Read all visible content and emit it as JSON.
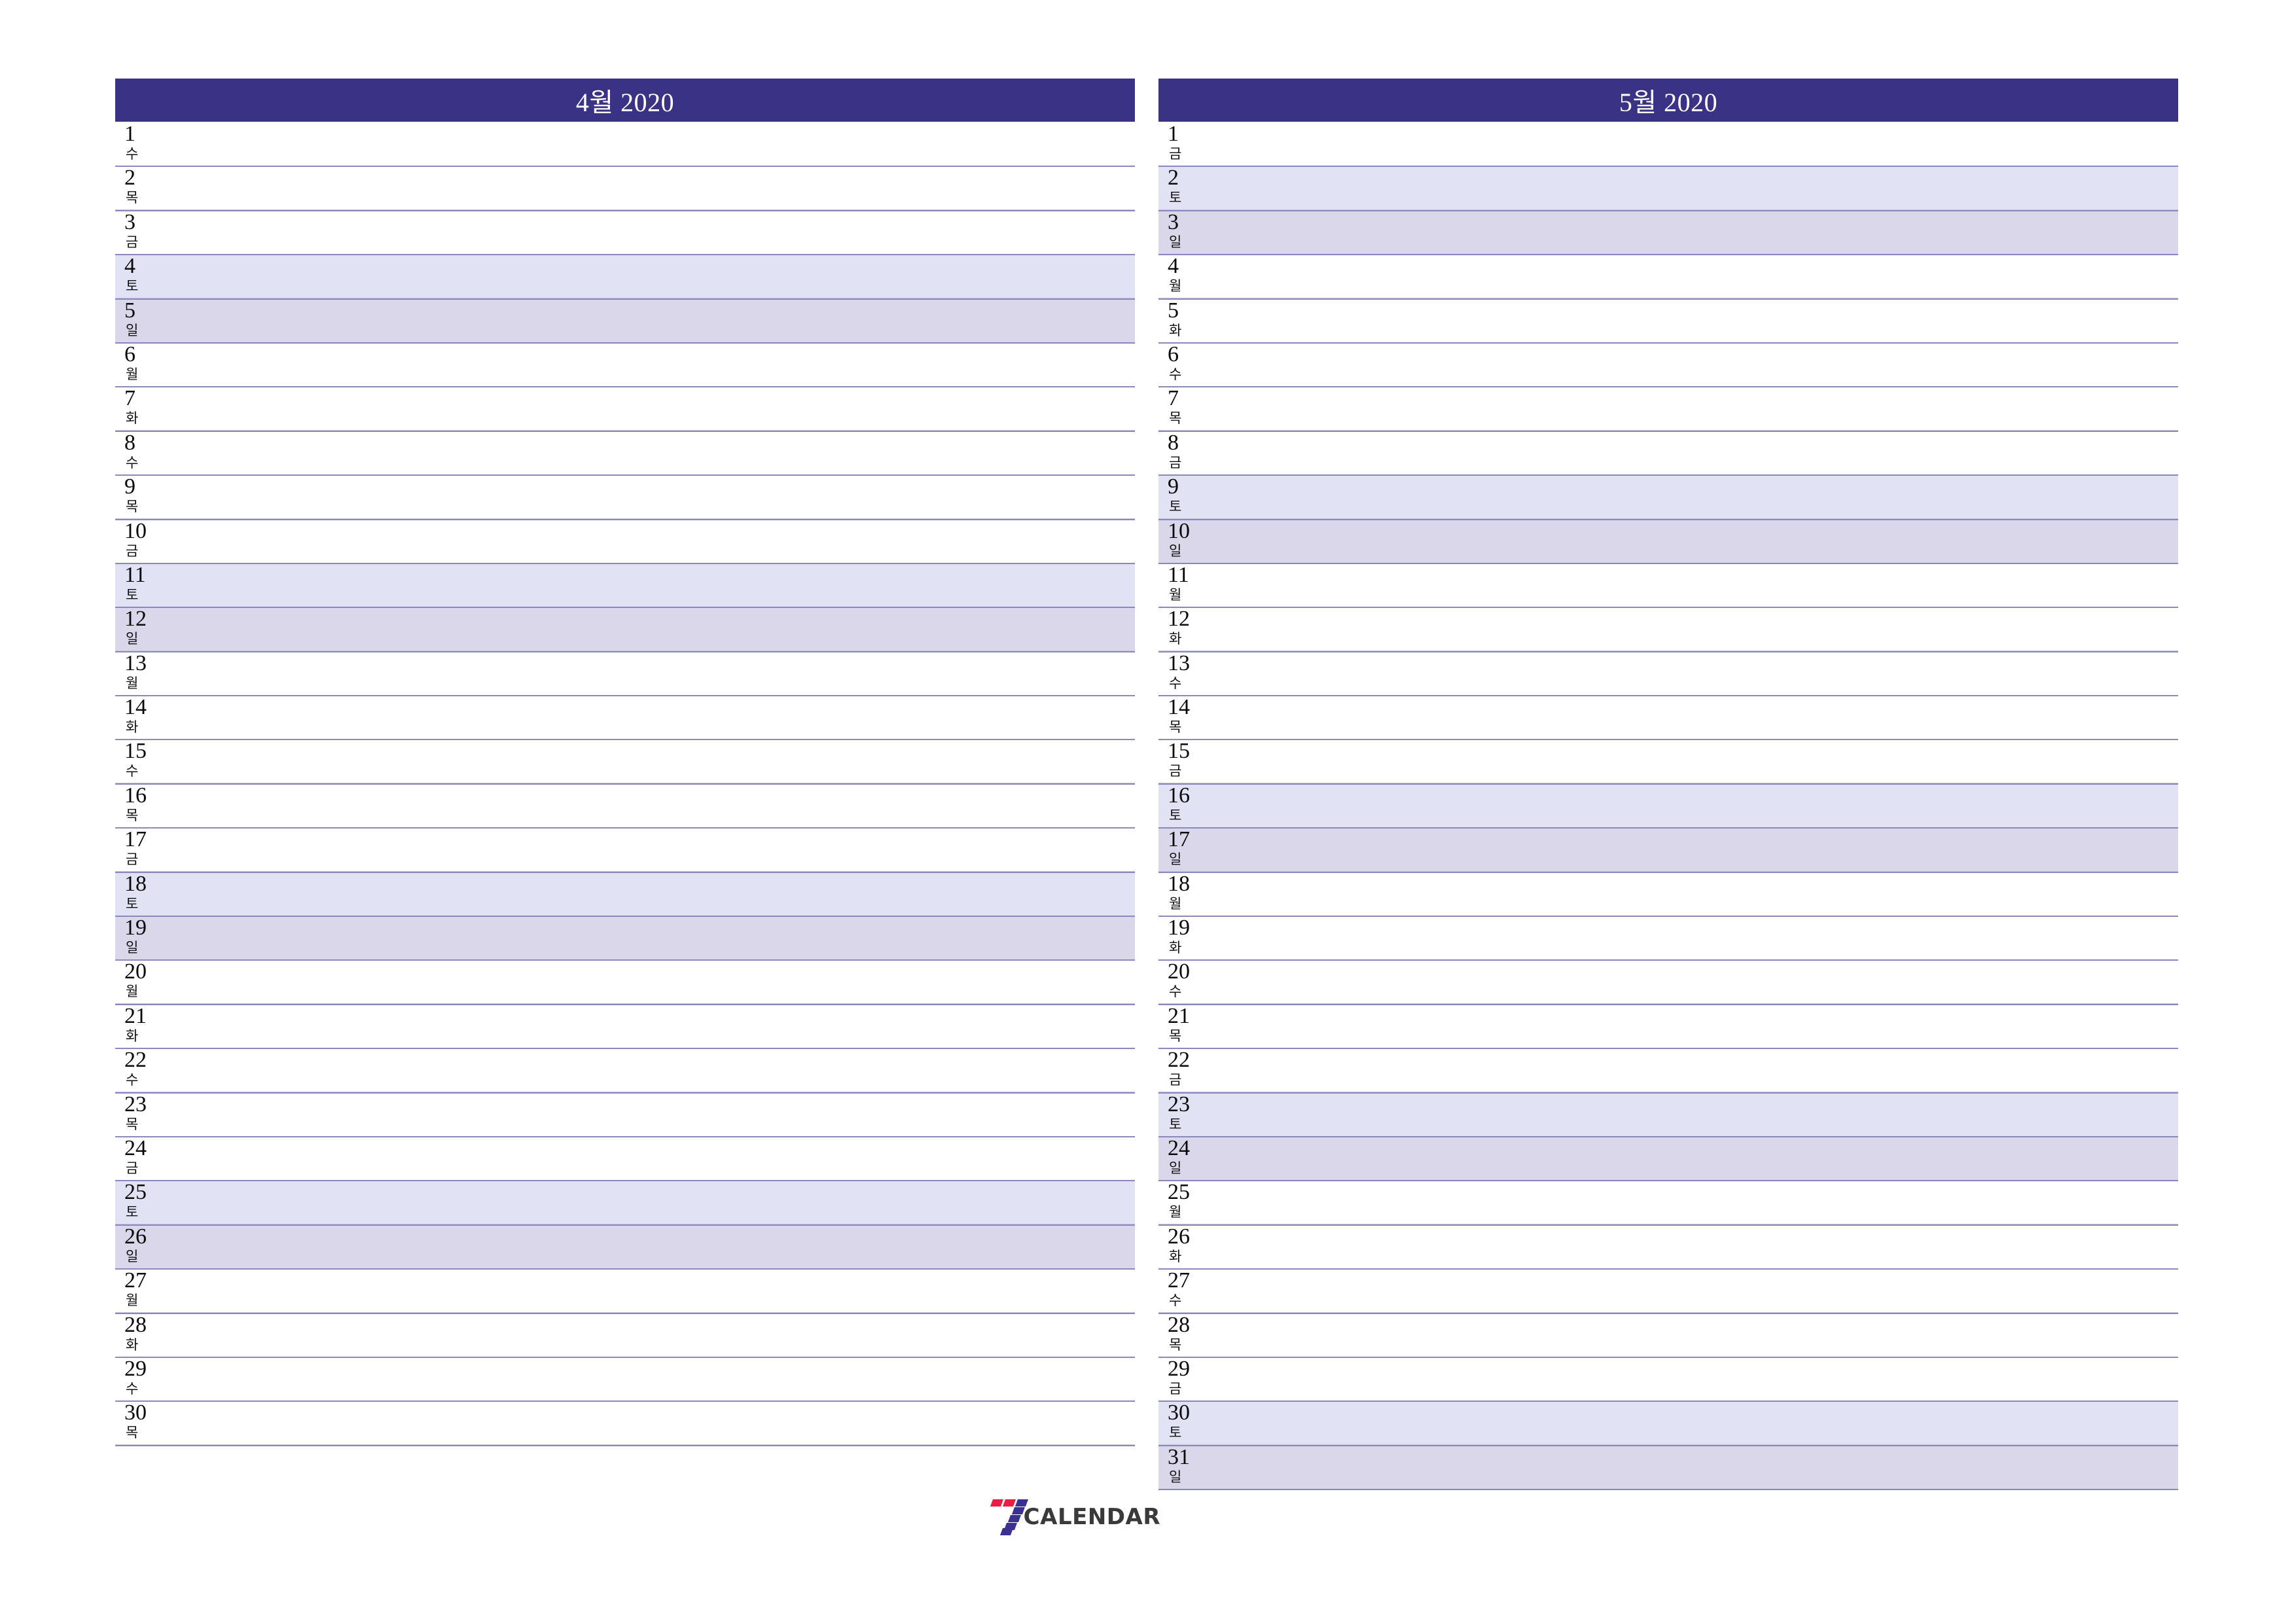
{
  "document": {
    "type": "printable-monthly-planner",
    "logo": {
      "text": "CALENDAR",
      "mark_name": "seven-calendar-logo",
      "colors": {
        "red": "#ec1c44",
        "purple": "#3b3192"
      }
    },
    "colors": {
      "header_bg": "#393285",
      "header_text": "#ffffff",
      "saturday_bg": "#e2e2f5",
      "sunday_bg": "#dbd7ea",
      "row_border": "#8c87bd",
      "inner_rule": "#c8c6df",
      "page_bg": "#ffffff"
    }
  },
  "months": [
    {
      "title": "4월 2020",
      "month_number": 4,
      "year": 2020,
      "days": [
        {
          "num": "1",
          "wd": "수",
          "type": "weekday"
        },
        {
          "num": "2",
          "wd": "목",
          "type": "weekday"
        },
        {
          "num": "3",
          "wd": "금",
          "type": "weekday"
        },
        {
          "num": "4",
          "wd": "토",
          "type": "sat"
        },
        {
          "num": "5",
          "wd": "일",
          "type": "sun"
        },
        {
          "num": "6",
          "wd": "월",
          "type": "weekday"
        },
        {
          "num": "7",
          "wd": "화",
          "type": "weekday"
        },
        {
          "num": "8",
          "wd": "수",
          "type": "weekday"
        },
        {
          "num": "9",
          "wd": "목",
          "type": "weekday"
        },
        {
          "num": "10",
          "wd": "금",
          "type": "weekday"
        },
        {
          "num": "11",
          "wd": "토",
          "type": "sat"
        },
        {
          "num": "12",
          "wd": "일",
          "type": "sun"
        },
        {
          "num": "13",
          "wd": "월",
          "type": "weekday"
        },
        {
          "num": "14",
          "wd": "화",
          "type": "weekday"
        },
        {
          "num": "15",
          "wd": "수",
          "type": "weekday"
        },
        {
          "num": "16",
          "wd": "목",
          "type": "weekday"
        },
        {
          "num": "17",
          "wd": "금",
          "type": "weekday"
        },
        {
          "num": "18",
          "wd": "토",
          "type": "sat"
        },
        {
          "num": "19",
          "wd": "일",
          "type": "sun"
        },
        {
          "num": "20",
          "wd": "월",
          "type": "weekday"
        },
        {
          "num": "21",
          "wd": "화",
          "type": "weekday"
        },
        {
          "num": "22",
          "wd": "수",
          "type": "weekday"
        },
        {
          "num": "23",
          "wd": "목",
          "type": "weekday"
        },
        {
          "num": "24",
          "wd": "금",
          "type": "weekday"
        },
        {
          "num": "25",
          "wd": "토",
          "type": "sat"
        },
        {
          "num": "26",
          "wd": "일",
          "type": "sun"
        },
        {
          "num": "27",
          "wd": "월",
          "type": "weekday"
        },
        {
          "num": "28",
          "wd": "화",
          "type": "weekday"
        },
        {
          "num": "29",
          "wd": "수",
          "type": "weekday"
        },
        {
          "num": "30",
          "wd": "목",
          "type": "weekday"
        }
      ]
    },
    {
      "title": "5월 2020",
      "month_number": 5,
      "year": 2020,
      "days": [
        {
          "num": "1",
          "wd": "금",
          "type": "weekday"
        },
        {
          "num": "2",
          "wd": "토",
          "type": "sat"
        },
        {
          "num": "3",
          "wd": "일",
          "type": "sun"
        },
        {
          "num": "4",
          "wd": "월",
          "type": "weekday"
        },
        {
          "num": "5",
          "wd": "화",
          "type": "weekday"
        },
        {
          "num": "6",
          "wd": "수",
          "type": "weekday"
        },
        {
          "num": "7",
          "wd": "목",
          "type": "weekday"
        },
        {
          "num": "8",
          "wd": "금",
          "type": "weekday"
        },
        {
          "num": "9",
          "wd": "토",
          "type": "sat"
        },
        {
          "num": "10",
          "wd": "일",
          "type": "sun"
        },
        {
          "num": "11",
          "wd": "월",
          "type": "weekday"
        },
        {
          "num": "12",
          "wd": "화",
          "type": "weekday"
        },
        {
          "num": "13",
          "wd": "수",
          "type": "weekday"
        },
        {
          "num": "14",
          "wd": "목",
          "type": "weekday"
        },
        {
          "num": "15",
          "wd": "금",
          "type": "weekday"
        },
        {
          "num": "16",
          "wd": "토",
          "type": "sat"
        },
        {
          "num": "17",
          "wd": "일",
          "type": "sun"
        },
        {
          "num": "18",
          "wd": "월",
          "type": "weekday"
        },
        {
          "num": "19",
          "wd": "화",
          "type": "weekday"
        },
        {
          "num": "20",
          "wd": "수",
          "type": "weekday"
        },
        {
          "num": "21",
          "wd": "목",
          "type": "weekday"
        },
        {
          "num": "22",
          "wd": "금",
          "type": "weekday"
        },
        {
          "num": "23",
          "wd": "토",
          "type": "sat"
        },
        {
          "num": "24",
          "wd": "일",
          "type": "sun"
        },
        {
          "num": "25",
          "wd": "월",
          "type": "weekday"
        },
        {
          "num": "26",
          "wd": "화",
          "type": "weekday"
        },
        {
          "num": "27",
          "wd": "수",
          "type": "weekday"
        },
        {
          "num": "28",
          "wd": "목",
          "type": "weekday"
        },
        {
          "num": "29",
          "wd": "금",
          "type": "weekday"
        },
        {
          "num": "30",
          "wd": "토",
          "type": "sat"
        },
        {
          "num": "31",
          "wd": "일",
          "type": "sun"
        }
      ]
    }
  ]
}
